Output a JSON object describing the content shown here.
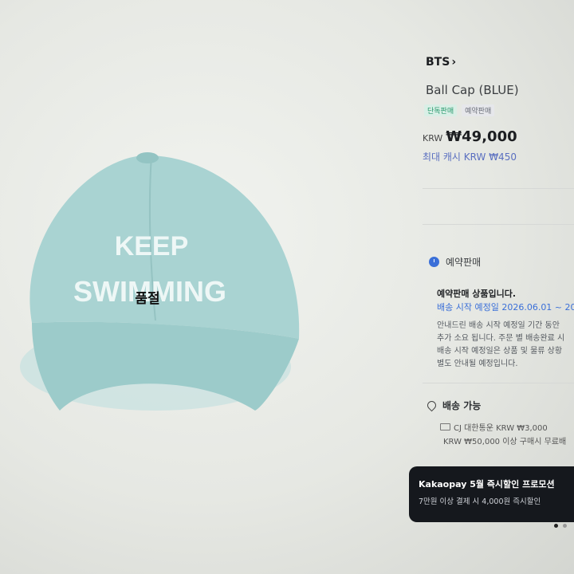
{
  "product": {
    "brand": "BTS",
    "brand_chevron": "›",
    "name": "Ball Cap (BLUE)",
    "tags": [
      "단독판매",
      "예약판매"
    ],
    "currency": "KRW",
    "price": "₩49,000",
    "max_cash": "최대 캐시 KRW ₩450",
    "sold_out_label": "품절",
    "image_text": [
      "KEEP",
      "SWIMMING"
    ],
    "image_color": "#a9d3d2"
  },
  "preorder": {
    "label": "예약판매",
    "icon": "clock-icon",
    "title": "예약판매 상품입니다.",
    "ship_date": "배송 시작 예정일 2026.06.01 ~ 20",
    "notice_lines": [
      "안내드린 배송 시작 예정일 기간 동안",
      "추가 소요 됩니다. 주문 별 배송완료 시",
      "배송 시작 예정일은 상품 및 물류 상황",
      "별도 안내될 예정입니다."
    ]
  },
  "delivery": {
    "label": "배송 가능",
    "icon": "location-pin-icon",
    "carrier": "CJ 대한통운 KRW ₩3,000",
    "free_shipping": "KRW ₩50,000 이상 구매시 무료배"
  },
  "promo": {
    "title": "Kakaopay 5월 즉시할인 프로모션",
    "subtitle": "7만원 이상 결제 시 4,000원 즉시할인"
  },
  "colors": {
    "accent_blue": "#3a6fd8",
    "tag_green": "#2a9a6e",
    "promo_bg": "#15181d"
  }
}
